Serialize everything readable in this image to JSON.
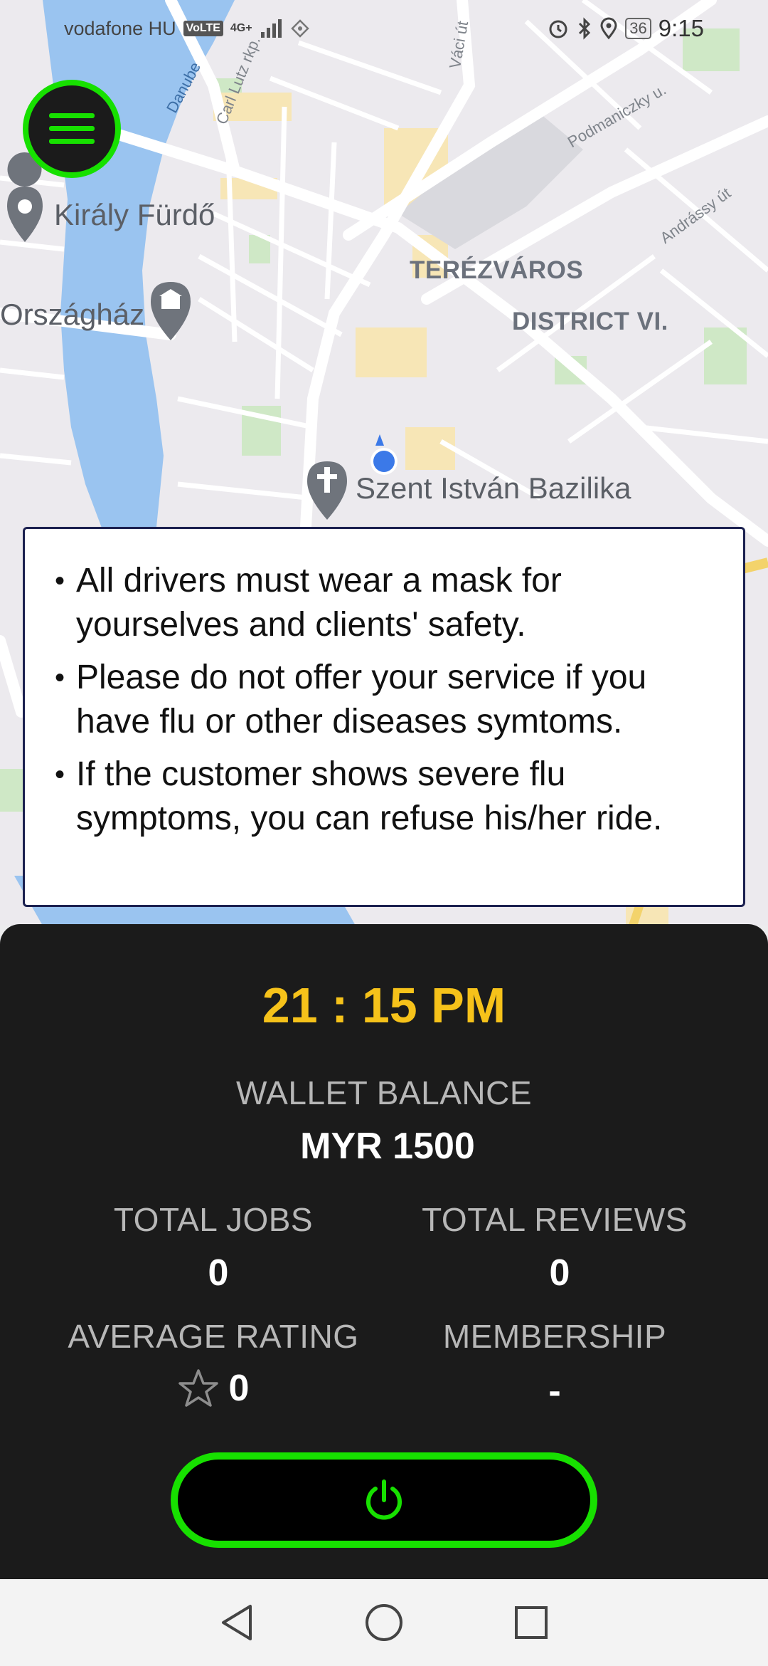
{
  "status_bar": {
    "carrier": "vodafone HU",
    "volte": "VoLTE",
    "network": "4G+",
    "battery": "36",
    "clock": "9:15"
  },
  "map": {
    "places": {
      "kiraly_furdo": "Király Fürdő",
      "orszaghaz": "Országház",
      "szent_istvan": "Szent István Bazilika"
    },
    "districts": {
      "terezvaros": "TERÉZVÁROS",
      "district_vi": "DISTRICT VI."
    },
    "streets": {
      "danube": "Danube",
      "carl_lutz": "Carl Lutz rkp.",
      "vaci_ut": "Váci út",
      "podmaniczky": "Podmaniczky u.",
      "andrassy": "Andrássy út"
    }
  },
  "notice": {
    "items": [
      "All drivers must wear a mask for yourselves and clients' safety.",
      "Please do not offer your service if you have flu or other diseases symtoms.",
      "If the customer shows severe flu symptoms, you can refuse his/her ride."
    ],
    "bullet": "•"
  },
  "panel": {
    "time": "21 : 15 PM",
    "wallet_label": "WALLET BALANCE",
    "wallet_value": "MYR 1500",
    "jobs_label": "TOTAL JOBS",
    "jobs_value": "0",
    "reviews_label": "TOTAL REVIEWS",
    "reviews_value": "0",
    "rating_label": "AVERAGE RATING",
    "rating_value": "0",
    "membership_label": "MEMBERSHIP",
    "membership_value": "-"
  },
  "colors": {
    "accent_green": "#17e000",
    "time_yellow": "#f6c21a",
    "panel_bg": "#1b1b1b"
  },
  "icons": {
    "menu": "hamburger-menu-icon",
    "power": "power-icon",
    "rating": "star-outline-icon",
    "nav_back": "triangle-back-icon",
    "nav_home": "circle-home-icon",
    "nav_recents": "square-recents-icon"
  }
}
